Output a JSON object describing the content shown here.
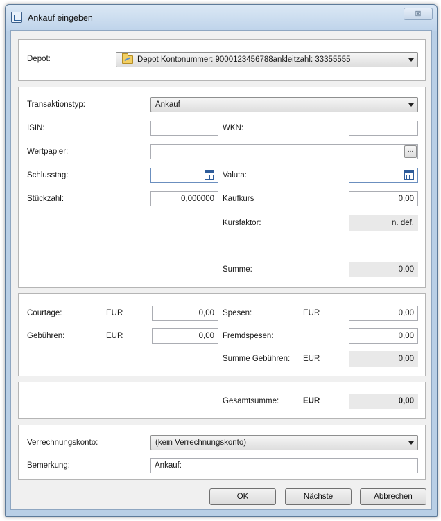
{
  "window": {
    "title": "Ankauf eingeben",
    "close_glyph": "⊠"
  },
  "depot": {
    "label": "Depot:",
    "value": "Depot Kontonummer: 9000123456788ankleitzahl: 33355555"
  },
  "transaction": {
    "type_label": "Transaktionstyp:",
    "type_value": "Ankauf",
    "isin_label": "ISIN:",
    "isin_value": "",
    "wkn_label": "WKN:",
    "wkn_value": "",
    "wertpapier_label": "Wertpapier:",
    "wertpapier_value": "",
    "browse_label": "...",
    "schlusstag_label": "Schlusstag:",
    "schlusstag_value": "",
    "valuta_label": "Valuta:",
    "valuta_value": "",
    "stueckzahl_label": "Stückzahl:",
    "stueckzahl_value": "0,000000",
    "kaufkurs_label": "Kaufkurs",
    "kaufkurs_value": "0,00",
    "kursfaktor_label": "Kursfaktor:",
    "kursfaktor_value": "n. def.",
    "summe_label": "Summe:",
    "summe_value": "0,00"
  },
  "fees": {
    "courtage_label": "Courtage:",
    "courtage_currency": "EUR",
    "courtage_value": "0,00",
    "spesen_label": "Spesen:",
    "spesen_currency": "EUR",
    "spesen_value": "0,00",
    "gebuehren_label": "Gebühren:",
    "gebuehren_currency": "EUR",
    "gebuehren_value": "0,00",
    "fremdspesen_label": "Fremdspesen:",
    "fremdspesen_value": "0,00",
    "summe_gebuehren_label": "Summe Gebühren:",
    "summe_gebuehren_currency": "EUR",
    "summe_gebuehren_value": "0,00"
  },
  "total": {
    "label": "Gesamtsumme:",
    "currency": "EUR",
    "value": "0,00"
  },
  "account": {
    "verrechnungskonto_label": "Verrechnungskonto:",
    "verrechnungskonto_value": "(kein Verrechnungskonto)",
    "bemerkung_label": "Bemerkung:",
    "bemerkung_value": "Ankauf:"
  },
  "buttons": {
    "ok": "OK",
    "next": "Nächste",
    "cancel": "Abbrechen"
  }
}
